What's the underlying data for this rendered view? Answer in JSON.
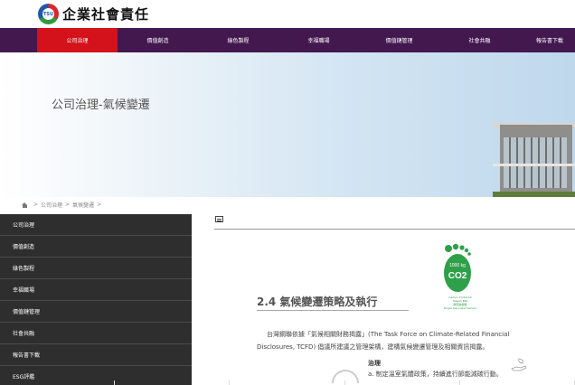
{
  "header": {
    "logo_mark": "TSU",
    "logo_text": "企業社會責任"
  },
  "nav": {
    "items": [
      {
        "label": "公司治理",
        "active": true
      },
      {
        "label": "價值創造"
      },
      {
        "label": "綠色製程"
      },
      {
        "label": "幸福職場"
      },
      {
        "label": "價值鏈管理"
      },
      {
        "label": "社會共融"
      },
      {
        "label": "報告書下載"
      }
    ]
  },
  "banner": {
    "title": "公司治理-氣候變遷"
  },
  "breadcrumb": {
    "items": [
      "公司治理",
      "氣候變遷"
    ]
  },
  "sidebar": {
    "items": [
      {
        "label": "公司治理"
      },
      {
        "label": "價值創造"
      },
      {
        "label": "綠色製程"
      },
      {
        "label": "幸福職場"
      },
      {
        "label": "價值鏈管理"
      },
      {
        "label": "社會共融"
      },
      {
        "label": "報告書下載"
      },
      {
        "label": "ESG評鑑"
      }
    ]
  },
  "content": {
    "cert": {
      "amount": "1000 kg",
      "co2": "CO2",
      "line1": "Carbon Footprint",
      "line2": "Taiwan EPA",
      "line3": "碳足跡標籤",
      "line4": "Single Use Label Version"
    },
    "heading": "2.4 氣候變遷策略及執行",
    "paragraph": "台灣鋼聯依據「氣候相關財務揭露」(The Task Force on Climate-Related Financial Disclosures, TCFD) 倡議所建議之管理架構，建構氣候變遷管理及相關資訊揭露。",
    "subheading": "治理",
    "sub_item": "a. 制定溫室氣體政策，持續進行節能減碳行動。"
  },
  "colors": {
    "nav_bg": "#43184f",
    "nav_active": "#d3121b",
    "sidebar_bg": "#2e2e2e",
    "cert_green": "#2fa04a"
  }
}
